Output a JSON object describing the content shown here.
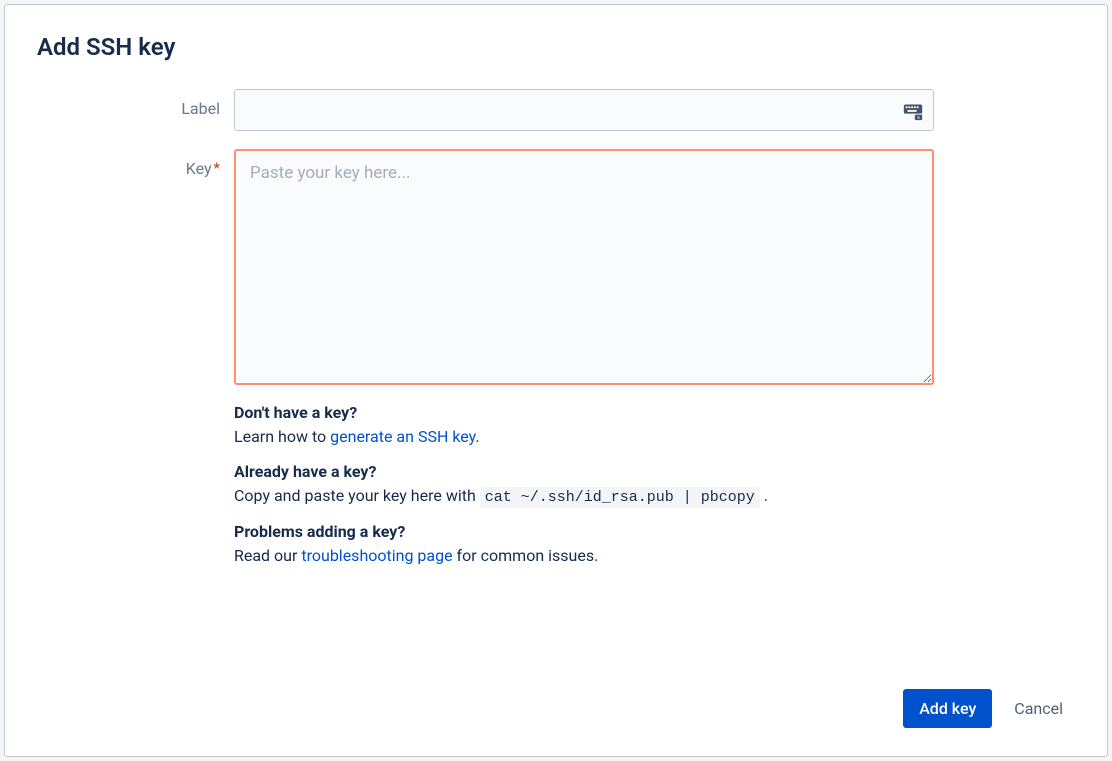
{
  "page": {
    "title": "Add SSH key"
  },
  "form": {
    "label_field": {
      "label": "Label",
      "value": ""
    },
    "key_field": {
      "label": "Key",
      "required_marker": "*",
      "placeholder": "Paste your key here...",
      "value": ""
    }
  },
  "help": {
    "no_key": {
      "heading": "Don't have a key?",
      "text_prefix": "Learn how to ",
      "link_text": "generate an SSH key",
      "text_suffix": "."
    },
    "have_key": {
      "heading": "Already have a key?",
      "text_prefix": "Copy and paste your key here with ",
      "code": "cat ~/.ssh/id_rsa.pub | pbcopy",
      "text_suffix": " ."
    },
    "problems": {
      "heading": "Problems adding a key?",
      "text_prefix": "Read our ",
      "link_text": "troubleshooting page",
      "text_suffix": " for common issues."
    }
  },
  "buttons": {
    "submit": "Add key",
    "cancel": "Cancel"
  }
}
